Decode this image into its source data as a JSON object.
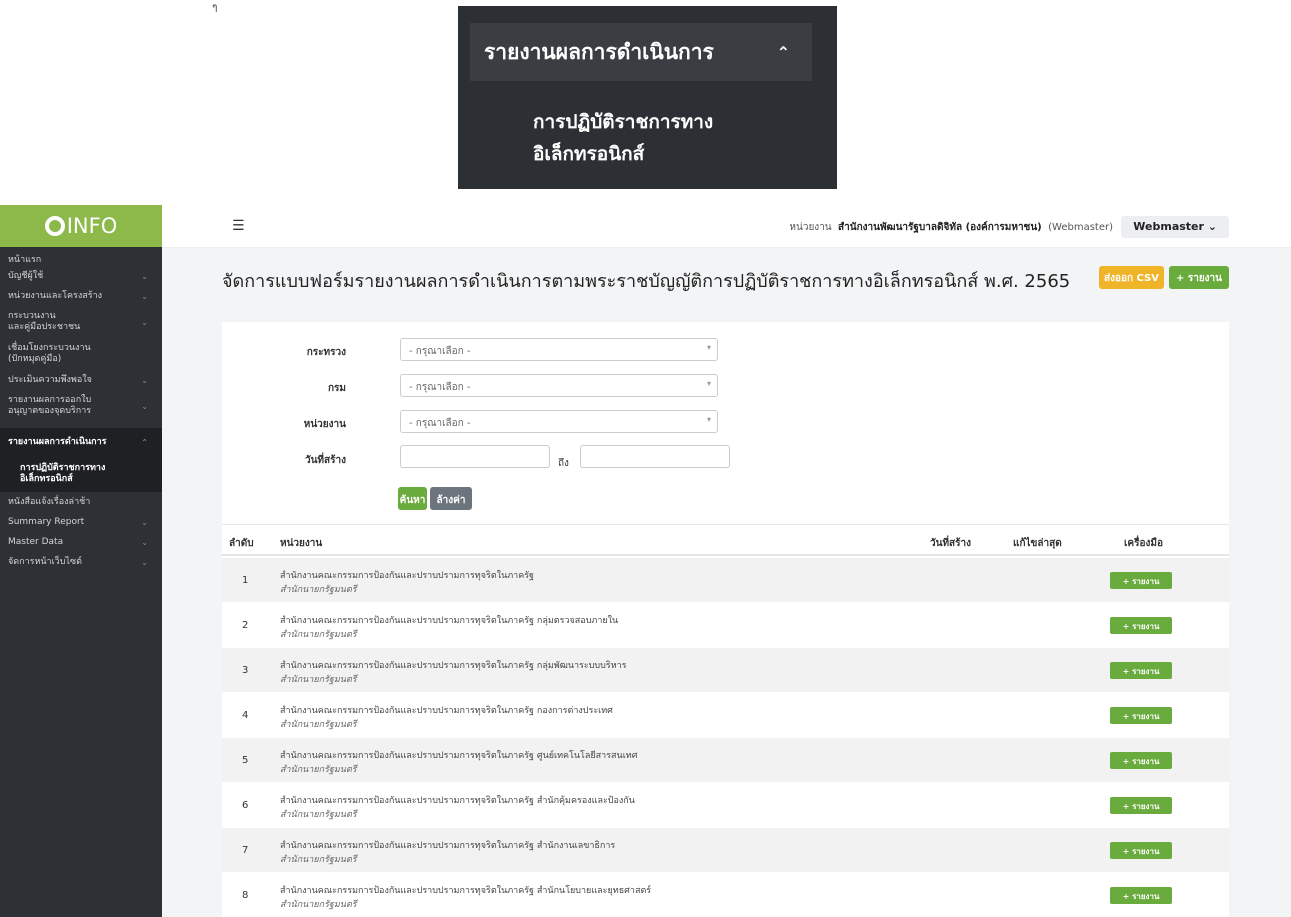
{
  "zoom": {
    "title": "รายงานผลการดำเนินการ",
    "sub_line1": "การปฏิบัติราชการทาง",
    "sub_line2": "อิเล็กทรอนิกส์"
  },
  "logo": "INFO",
  "top_mark": "ๆ",
  "sidebar": {
    "items": [
      {
        "label": "หน้าแรก",
        "chev": ""
      },
      {
        "label": "บัญชีผู้ใช้",
        "chev": "⌄"
      },
      {
        "label": "หน่วยงานและโครงสร้าง",
        "chev": "⌄"
      },
      {
        "label": "กระบวนงาน\nและคู่มือประชาชน",
        "chev": "⌄"
      },
      {
        "label": "เชื่อมโยงกระบวนงาน\n(ปักหมุดคู่มือ)",
        "chev": ""
      },
      {
        "label": "ประเมินความพึงพอใจ",
        "chev": "⌄"
      },
      {
        "label": "รายงานผลการออกใบ\nอนุญาตของจุดบริการ",
        "chev": "⌄"
      },
      {
        "label": "รายงานผลการดำเนินการ",
        "chev": "⌃"
      },
      {
        "label": "การปฏิบัติราชการทาง\nอิเล็กทรอนิกส์",
        "chev": ""
      },
      {
        "label": "หนังสือแจ้งเรื่องล่าช้า",
        "chev": ""
      },
      {
        "label": "Summary Report",
        "chev": "⌄"
      },
      {
        "label": "Master Data",
        "chev": "⌄"
      },
      {
        "label": "จัดการหน้าเว็บไซต์",
        "chev": "⌄"
      }
    ]
  },
  "topbar": {
    "unit_label": "หน่วยงาน",
    "unit_name": "สำนักงานพัฒนารัฐบาลดิจิทัล (องค์การมหาชน)",
    "role": "(Webmaster)",
    "user": "Webmaster",
    "user_chev": "⌄"
  },
  "page": {
    "title": "จัดการแบบฟอร์มรายงานผลการดำเนินการตามพระราชบัญญัติการปฏิบัติราชการทางอิเล็กทรอนิกส์ พ.ศ. 2565",
    "csv_label": "ส่งออก CSV",
    "add_label": "+ รายงาน"
  },
  "filters": {
    "ministry_label": "กระทรวง",
    "ministry_value": "- กรุณาเลือก -",
    "dept_label": "กรม",
    "dept_value": "- กรุณาเลือก -",
    "unit_label": "หน่วยงาน",
    "unit_value": "- กรุณาเลือก -",
    "date_label": "วันที่สร้าง",
    "to_label": "ถึง",
    "search_label": "ค้นหา",
    "clear_label": "ล้างค่า"
  },
  "table": {
    "headers": {
      "no": "ลำดับ",
      "unit": "หน่วยงาน",
      "created": "วันที่สร้าง",
      "edited": "แก้ไขล่าสุด",
      "tools": "เครื่องมือ"
    },
    "row_button": "+ รายงาน",
    "rows": [
      {
        "no": "1",
        "name": "สำนักงานคณะกรรมการป้องกันและปราบปรามการทุจริตในภาครัฐ",
        "sub": "สำนักนายกรัฐมนตรี"
      },
      {
        "no": "2",
        "name": "สำนักงานคณะกรรมการป้องกันและปราบปรามการทุจริตในภาครัฐ กลุ่มตรวจสอบภายใน",
        "sub": "สำนักนายกรัฐมนตรี"
      },
      {
        "no": "3",
        "name": "สำนักงานคณะกรรมการป้องกันและปราบปรามการทุจริตในภาครัฐ กลุ่มพัฒนาระบบบริหาร",
        "sub": "สำนักนายกรัฐมนตรี"
      },
      {
        "no": "4",
        "name": "สำนักงานคณะกรรมการป้องกันและปราบปรามการทุจริตในภาครัฐ กองการต่างประเทศ",
        "sub": "สำนักนายกรัฐมนตรี"
      },
      {
        "no": "5",
        "name": "สำนักงานคณะกรรมการป้องกันและปราบปรามการทุจริตในภาครัฐ ศูนย์เทคโนโลยีสารสนเทศ",
        "sub": "สำนักนายกรัฐมนตรี"
      },
      {
        "no": "6",
        "name": "สำนักงานคณะกรรมการป้องกันและปราบปรามการทุจริตในภาครัฐ สำนักคุ้มครองและป้องกัน",
        "sub": "สำนักนายกรัฐมนตรี"
      },
      {
        "no": "7",
        "name": "สำนักงานคณะกรรมการป้องกันและปราบปรามการทุจริตในภาครัฐ สำนักงานเลขาธิการ",
        "sub": "สำนักนายกรัฐมนตรี"
      },
      {
        "no": "8",
        "name": "สำนักงานคณะกรรมการป้องกันและปราบปรามการทุจริตในภาครัฐ สำนักนโยบายและยุทธศาสตร์",
        "sub": "สำนักนายกรัฐมนตรี"
      }
    ]
  },
  "colors": {
    "brand": "#8cb94a",
    "accent_green": "#6aab3d",
    "csv_yellow": "#f0b429",
    "sidebar_bg": "#2d3035"
  }
}
